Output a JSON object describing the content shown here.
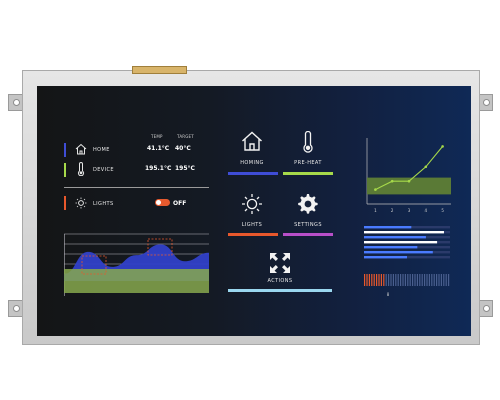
{
  "left_panel": {
    "column_headers": {
      "temp": "TEMP",
      "target": "TARGET"
    },
    "rows": [
      {
        "label": "HOME",
        "temp": "41.1°C",
        "target": "40°C",
        "marker_color": "#3f4dd6",
        "icon": "house-icon"
      },
      {
        "label": "DEVICE",
        "temp": "195.1°C",
        "target": "195°C",
        "marker_color": "#a6d94a",
        "icon": "thermometer-icon"
      }
    ],
    "lights": {
      "label": "LIGHTS",
      "state": "OFF",
      "marker_color": "#e8582c",
      "icon": "sun-icon"
    }
  },
  "tiles": [
    {
      "label": "HOMING",
      "icon": "house-icon",
      "bar_color": "#3f4dd6"
    },
    {
      "label": "PRE-HEAT",
      "icon": "thermometer-icon",
      "bar_color": "#a6d94a"
    },
    {
      "label": "LIGHTS",
      "icon": "sun-icon",
      "bar_color": "#e8582c"
    },
    {
      "label": "SETTINGS",
      "icon": "gear-icon",
      "bar_color": "#b84fc9"
    },
    {
      "label": "ACTIONS",
      "icon": "expand-arrows-icon",
      "bar_color": "#9ad7ef"
    }
  ],
  "line_chart": {
    "x_ticks": [
      "1",
      "2",
      "3",
      "4",
      "5"
    ],
    "colors": {
      "line": "#a6d94a",
      "band": "#5a7a36"
    }
  },
  "bar_chart": {
    "color": "#4a7bff"
  },
  "tick_bar": {
    "label": "8",
    "color": "#e8582c"
  },
  "chart_data": [
    {
      "type": "area",
      "series": [
        {
          "values": [
            0.15,
            0.62,
            0.3,
            0.55,
            0.78,
            0.42,
            0.6
          ]
        }
      ],
      "colors": {
        "fill": "#3040c8",
        "band": "#86a84e",
        "grid": "#b8b8c0",
        "markers": "#e8582c"
      }
    },
    {
      "type": "line",
      "x": [
        1,
        2,
        3,
        4,
        5
      ],
      "series": [
        {
          "values": [
            12,
            19,
            19,
            31,
            48
          ]
        }
      ],
      "band": [
        8,
        22
      ],
      "xlim": [
        0.5,
        5.5
      ],
      "ylim": [
        0,
        55
      ]
    },
    {
      "type": "bar",
      "orientation": "horizontal",
      "values": [
        0.55,
        0.93,
        0.72,
        0.85,
        0.62,
        0.8,
        0.5
      ]
    }
  ]
}
